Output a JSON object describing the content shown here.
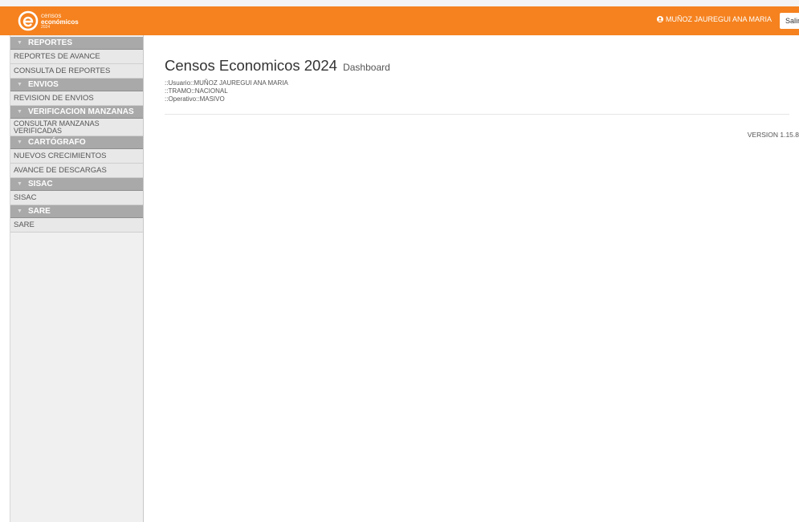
{
  "brand": {
    "line1": "censos",
    "line2": "económicos",
    "line3": "2024"
  },
  "header": {
    "user_name": "MUÑOZ JAUREGUI ANA MARIA",
    "exit_label": "Salir",
    "color": "#f5821f"
  },
  "sidebar": {
    "sections": [
      {
        "title": "REPORTES",
        "items": [
          "REPORTES DE AVANCE",
          "CONSULTA DE REPORTES"
        ]
      },
      {
        "title": "ENVIOS",
        "items": [
          "REVISION DE ENVIOS"
        ]
      },
      {
        "title": "VERIFICACION MANZANAS",
        "items": [
          "CONSULTAR MANZANAS VERIFICADAS"
        ]
      },
      {
        "title": "CARTÓGRAFO",
        "items": [
          "NUEVOS CRECIMIENTOS",
          "AVANCE DE DESCARGAS"
        ]
      },
      {
        "title": "SISAC",
        "items": [
          "SISAC"
        ]
      },
      {
        "title": "SARE",
        "items": [
          "SARE"
        ]
      }
    ]
  },
  "main": {
    "title": "Censos Economicos 2024",
    "subtitle": "Dashboard",
    "usuario": "::Usuario::MUÑOZ JAUREGUI ANA MARIA",
    "tramo": "::TRAMO::NACIONAL",
    "operativo": "::Operativo::MASIVO",
    "version": "VERSION 1.15.8"
  }
}
